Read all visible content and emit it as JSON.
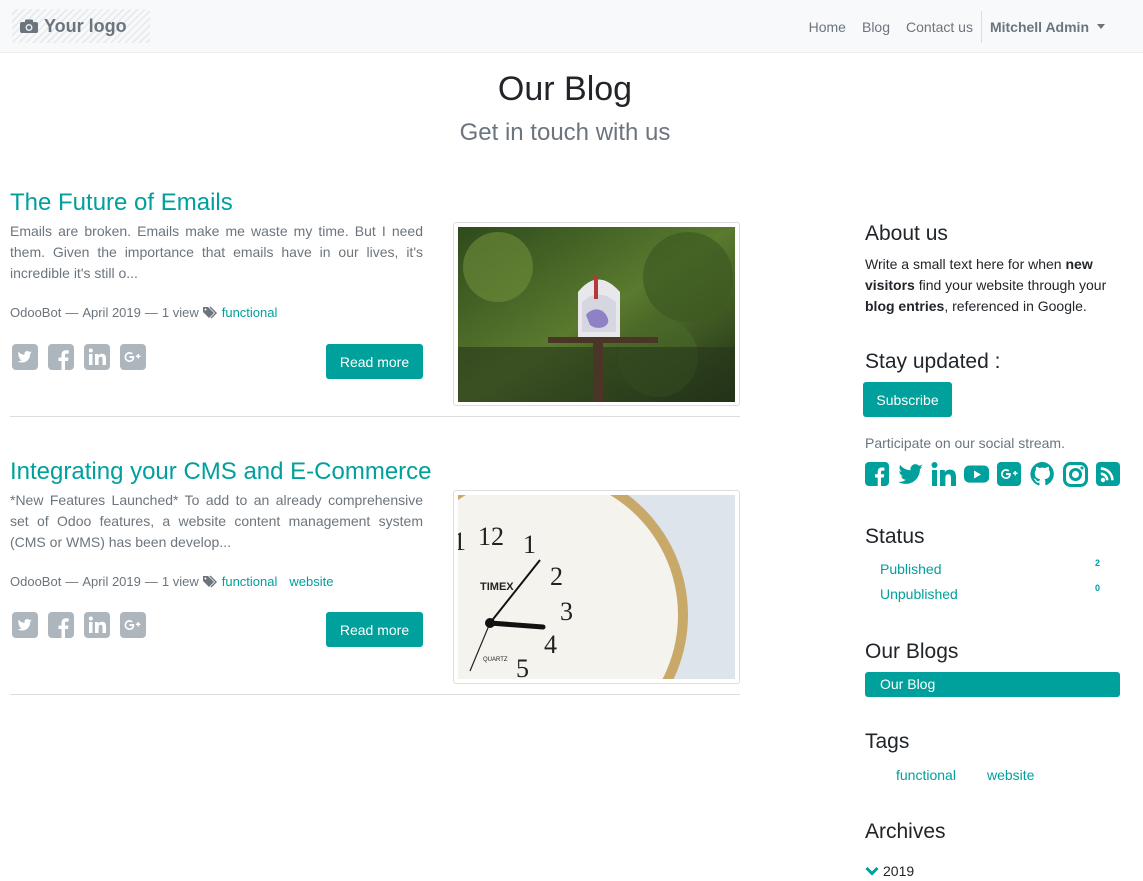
{
  "navbar": {
    "logo_text": "Your logo",
    "links": [
      "Home",
      "Blog",
      "Contact us"
    ],
    "user": "Mitchell Admin"
  },
  "header": {
    "title": "Our Blog",
    "subtitle": "Get in touch with us"
  },
  "posts": [
    {
      "title": "The Future of Emails",
      "teaser": "Emails are broken. Emails make me waste my time. But I need them. Given the importance that emails have in our lives, it's incredible it's still o...",
      "author": "OdooBot",
      "date": "April 2019",
      "views": "1 view",
      "tags": [
        "functional"
      ],
      "read_more": "Read more",
      "image": "mailbox"
    },
    {
      "title": "Integrating your CMS and E-Commerce",
      "teaser": "*New Features Launched* To add to an already comprehensive set of Odoo features, a website content management system (CMS or WMS) has been develop...",
      "author": "OdooBot",
      "date": "April 2019",
      "views": "1 view",
      "tags": [
        "functional",
        "website"
      ],
      "read_more": "Read more",
      "image": "clock"
    }
  ],
  "meta_separator": "—",
  "share_icons": [
    "twitter-icon",
    "facebook-icon",
    "linkedin-icon",
    "google-plus-icon"
  ],
  "sidebar": {
    "about": {
      "heading": "About us",
      "text_1": "Write a small text here for when ",
      "bold_1": "new visitors",
      "text_2": " find your website through your ",
      "bold_2": "blog entries",
      "text_3": ", referenced in Google."
    },
    "stay": {
      "heading": "Stay updated :",
      "subscribe": "Subscribe",
      "social_text": "Participate on our social stream.",
      "social_icons": [
        "facebook-icon",
        "twitter-icon",
        "linkedin-icon",
        "youtube-icon",
        "google-plus-icon",
        "github-icon",
        "instagram-icon",
        "rss-icon"
      ]
    },
    "status": {
      "heading": "Status",
      "items": [
        {
          "label": "Published",
          "count": "2"
        },
        {
          "label": "Unpublished",
          "count": "0"
        }
      ]
    },
    "blogs": {
      "heading": "Our Blogs",
      "items": [
        "Our Blog"
      ]
    },
    "tags": {
      "heading": "Tags",
      "items": [
        "functional",
        "website"
      ]
    },
    "archives": {
      "heading": "Archives",
      "years": [
        "2019"
      ]
    }
  },
  "colors": {
    "accent": "#00a09d",
    "muted": "#6c757d",
    "text": "#212529"
  }
}
